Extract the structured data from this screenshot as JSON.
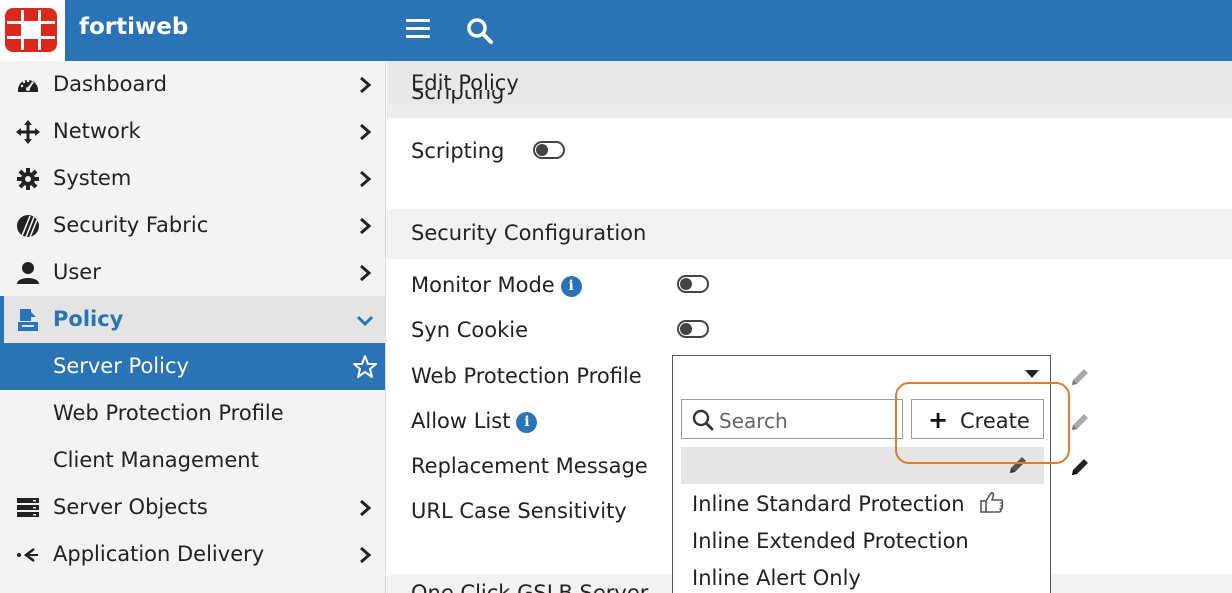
{
  "app": {
    "brand": "fortiweb"
  },
  "sidebar": {
    "items": [
      {
        "label": "Dashboard",
        "icon": "dashboard-icon"
      },
      {
        "label": "Network",
        "icon": "network-icon"
      },
      {
        "label": "System",
        "icon": "gear-icon"
      },
      {
        "label": "Security Fabric",
        "icon": "security-fabric-icon"
      },
      {
        "label": "User",
        "icon": "user-icon"
      },
      {
        "label": "Policy",
        "icon": "policy-icon",
        "expanded": true
      },
      {
        "label": "Server Policy",
        "selected": true,
        "sub": true
      },
      {
        "label": "Web Protection Profile",
        "sub": true
      },
      {
        "label": "Client Management",
        "sub": true
      },
      {
        "label": "Server Objects",
        "icon": "server-icon"
      },
      {
        "label": "Application Delivery",
        "icon": "application-delivery-icon"
      }
    ]
  },
  "main": {
    "header_title": "Edit Policy",
    "ghost_heading": "Scripting",
    "scripting_label": "Scripting",
    "scripting_on": false,
    "section_title": "Security Configuration",
    "monitor_mode_label": "Monitor Mode",
    "monitor_mode_on": false,
    "syn_cookie_label": "Syn Cookie",
    "syn_cookie_on": false,
    "web_protection_profile_label": "Web Protection Profile",
    "web_protection_profile_value": "",
    "allow_list_label": "Allow List",
    "replacement_message_label": "Replacement Message",
    "url_case_label": "URL Case Sensitivity",
    "bottom_section_title": "One Click GSLB Server"
  },
  "dropdown": {
    "search_placeholder": "Search",
    "create_label": "Create",
    "options": [
      {
        "label": "Inline Standard Protection",
        "recommended": true
      },
      {
        "label": "Inline Extended Protection"
      },
      {
        "label": "Inline Alert Only"
      }
    ]
  },
  "colors": {
    "brand_blue": "#2b73b7",
    "logo_red": "#da291c",
    "highlight_orange": "#e27b2f"
  }
}
